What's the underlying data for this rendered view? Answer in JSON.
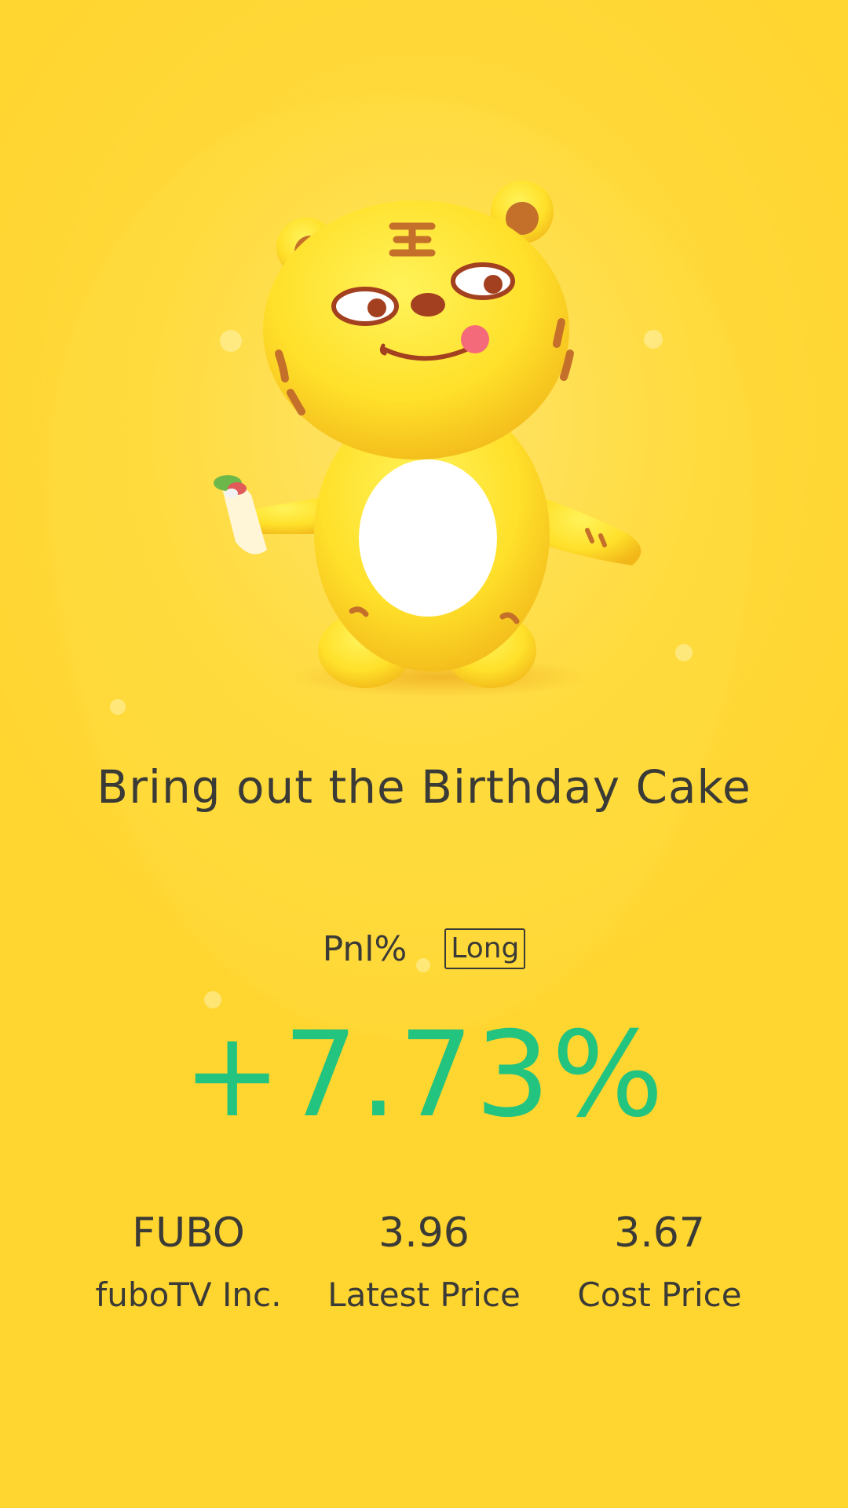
{
  "headline": "Bring out the Birthday Cake",
  "pnl": {
    "label": "Pnl%",
    "position_badge": "Long",
    "value": "+7.73%"
  },
  "stats": [
    {
      "value": "FUBO",
      "label": "fuboTV Inc."
    },
    {
      "value": "3.96",
      "label": "Latest Price"
    },
    {
      "value": "3.67",
      "label": "Cost Price"
    }
  ],
  "illustration": {
    "icon": "tiger-mascot-icon"
  },
  "colors": {
    "background": "#ffd530",
    "text": "#3a3a36",
    "gain": "#23c47f"
  }
}
